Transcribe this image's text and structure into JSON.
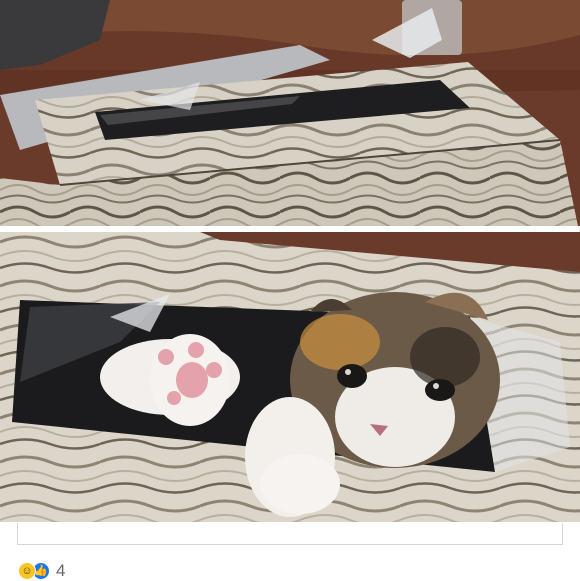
{
  "post": {
    "reactions": {
      "icons": [
        "haha-emoji-icon",
        "like-thumb-icon"
      ],
      "count": "4"
    }
  },
  "colors": {
    "like_blue": "#1877f2",
    "haha_yellow": "#f7c624",
    "count_gray": "#65676b"
  }
}
